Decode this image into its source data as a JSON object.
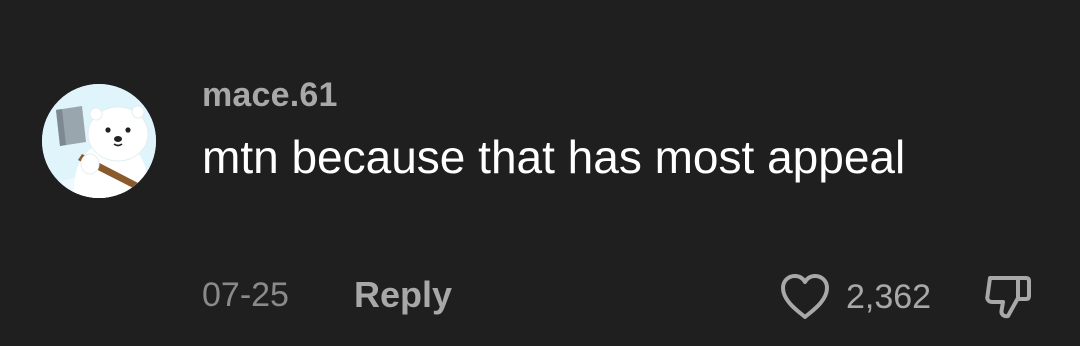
{
  "comment": {
    "username": "mace.61",
    "text": "mtn because that has most appeal",
    "date": "07-25",
    "reply_label": "Reply",
    "like_count": "2,362",
    "avatar_icon": "polar-bear-with-axe-avatar",
    "like_icon": "heart-outline-icon",
    "dislike_icon": "thumbs-down-icon"
  },
  "colors": {
    "background": "#1f1f1f",
    "text_primary": "#ffffff",
    "text_secondary": "#a8a8a8",
    "text_muted": "#8a8a8a"
  }
}
